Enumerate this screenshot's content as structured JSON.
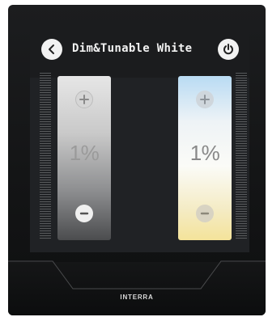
{
  "header": {
    "title": "Dim&Tunable White",
    "back_icon": "chevron-left-icon",
    "power_icon": "power-icon"
  },
  "sliders": [
    {
      "name": "dim",
      "value": "1%",
      "plus_icon": "plus-icon",
      "minus_icon": "minus-icon"
    },
    {
      "name": "tunable-white",
      "value": "1%",
      "plus_icon": "plus-icon",
      "minus_icon": "minus-icon"
    }
  ],
  "device": {
    "brand": "INTERRA"
  },
  "colors": {
    "device_body": "#161718",
    "screen_bg": "#202225",
    "warm": "#f4e39a",
    "cool": "#b9dbf3"
  }
}
